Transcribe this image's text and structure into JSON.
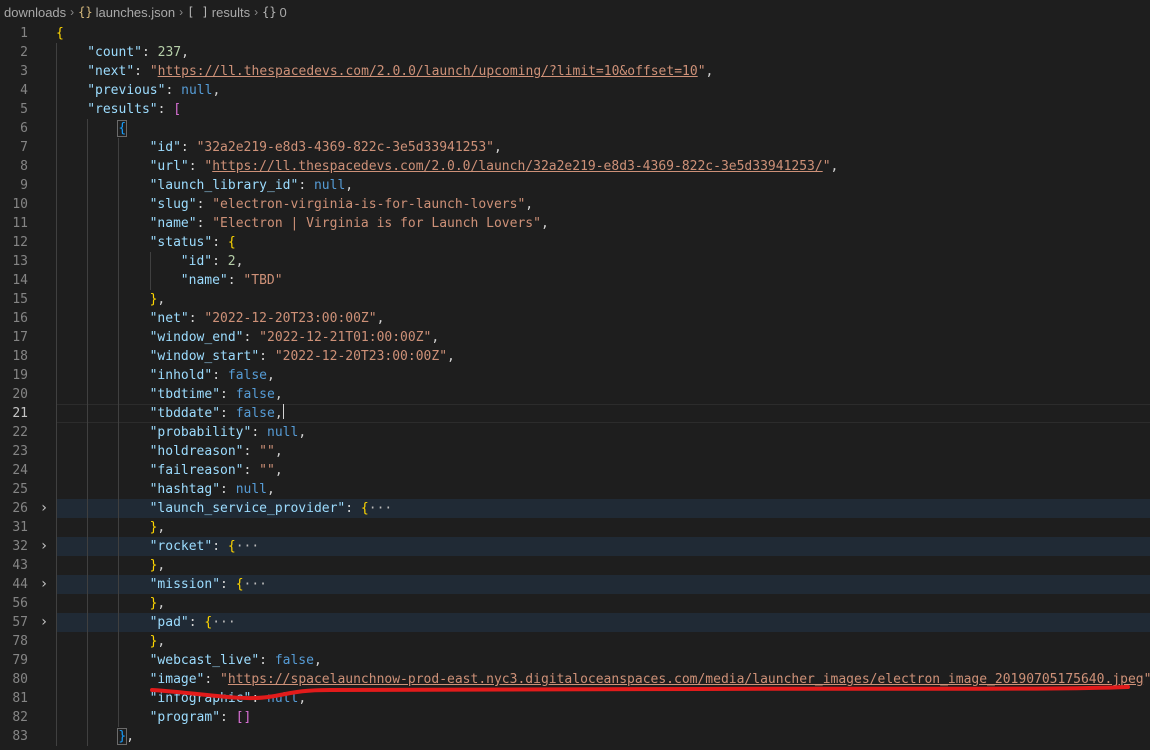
{
  "breadcrumb": {
    "items": [
      {
        "icon": "",
        "label": "downloads"
      },
      {
        "icon": "{}",
        "label": "launches.json"
      },
      {
        "icon": "[ ]",
        "label": "results"
      },
      {
        "icon": "{}",
        "label": "0"
      }
    ]
  },
  "lines": [
    {
      "num": "1",
      "indent": 0,
      "tokens": [
        [
          "{",
          "b1"
        ]
      ]
    },
    {
      "num": "2",
      "indent": 1,
      "tokens": [
        [
          "\"count\"",
          "k"
        ],
        [
          ": ",
          "p"
        ],
        [
          "237",
          "n"
        ],
        [
          ",",
          "p"
        ]
      ]
    },
    {
      "num": "3",
      "indent": 1,
      "tokens": [
        [
          "\"next\"",
          "k"
        ],
        [
          ": ",
          "p"
        ],
        [
          "\"",
          "s"
        ],
        [
          "https://ll.thespacedevs.com/2.0.0/launch/upcoming/?limit=10&offset=10",
          "u"
        ],
        [
          "\"",
          "s"
        ],
        [
          ",",
          "p"
        ]
      ]
    },
    {
      "num": "4",
      "indent": 1,
      "tokens": [
        [
          "\"previous\"",
          "k"
        ],
        [
          ": ",
          "p"
        ],
        [
          "null",
          "kw"
        ],
        [
          ",",
          "p"
        ]
      ]
    },
    {
      "num": "5",
      "indent": 1,
      "tokens": [
        [
          "\"results\"",
          "k"
        ],
        [
          ": ",
          "p"
        ],
        [
          "[",
          "b2"
        ]
      ]
    },
    {
      "num": "6",
      "indent": 2,
      "tokens": [
        [
          "{",
          "b3 box"
        ]
      ]
    },
    {
      "num": "7",
      "indent": 3,
      "tokens": [
        [
          "\"id\"",
          "k"
        ],
        [
          ": ",
          "p"
        ],
        [
          "\"32a2e219-e8d3-4369-822c-3e5d33941253\"",
          "s"
        ],
        [
          ",",
          "p"
        ]
      ]
    },
    {
      "num": "8",
      "indent": 3,
      "tokens": [
        [
          "\"url\"",
          "k"
        ],
        [
          ": ",
          "p"
        ],
        [
          "\"",
          "s"
        ],
        [
          "https://ll.thespacedevs.com/2.0.0/launch/32a2e219-e8d3-4369-822c-3e5d33941253/",
          "u"
        ],
        [
          "\"",
          "s"
        ],
        [
          ",",
          "p"
        ]
      ]
    },
    {
      "num": "9",
      "indent": 3,
      "tokens": [
        [
          "\"launch_library_id\"",
          "k"
        ],
        [
          ": ",
          "p"
        ],
        [
          "null",
          "kw"
        ],
        [
          ",",
          "p"
        ]
      ]
    },
    {
      "num": "10",
      "indent": 3,
      "tokens": [
        [
          "\"slug\"",
          "k"
        ],
        [
          ": ",
          "p"
        ],
        [
          "\"electron-virginia-is-for-launch-lovers\"",
          "s"
        ],
        [
          ",",
          "p"
        ]
      ]
    },
    {
      "num": "11",
      "indent": 3,
      "tokens": [
        [
          "\"name\"",
          "k"
        ],
        [
          ": ",
          "p"
        ],
        [
          "\"Electron | Virginia is for Launch Lovers\"",
          "s"
        ],
        [
          ",",
          "p"
        ]
      ]
    },
    {
      "num": "12",
      "indent": 3,
      "tokens": [
        [
          "\"status\"",
          "k"
        ],
        [
          ": ",
          "p"
        ],
        [
          "{",
          "b1"
        ]
      ]
    },
    {
      "num": "13",
      "indent": 4,
      "tokens": [
        [
          "\"id\"",
          "k"
        ],
        [
          ": ",
          "p"
        ],
        [
          "2",
          "n"
        ],
        [
          ",",
          "p"
        ]
      ]
    },
    {
      "num": "14",
      "indent": 4,
      "tokens": [
        [
          "\"name\"",
          "k"
        ],
        [
          ": ",
          "p"
        ],
        [
          "\"TBD\"",
          "s"
        ]
      ]
    },
    {
      "num": "15",
      "indent": 3,
      "tokens": [
        [
          "}",
          "b1"
        ],
        [
          ",",
          "p"
        ]
      ]
    },
    {
      "num": "16",
      "indent": 3,
      "tokens": [
        [
          "\"net\"",
          "k"
        ],
        [
          ": ",
          "p"
        ],
        [
          "\"2022-12-20T23:00:00Z\"",
          "s"
        ],
        [
          ",",
          "p"
        ]
      ]
    },
    {
      "num": "17",
      "indent": 3,
      "tokens": [
        [
          "\"window_end\"",
          "k"
        ],
        [
          ": ",
          "p"
        ],
        [
          "\"2022-12-21T01:00:00Z\"",
          "s"
        ],
        [
          ",",
          "p"
        ]
      ]
    },
    {
      "num": "18",
      "indent": 3,
      "tokens": [
        [
          "\"window_start\"",
          "k"
        ],
        [
          ": ",
          "p"
        ],
        [
          "\"2022-12-20T23:00:00Z\"",
          "s"
        ],
        [
          ",",
          "p"
        ]
      ]
    },
    {
      "num": "19",
      "indent": 3,
      "tokens": [
        [
          "\"inhold\"",
          "k"
        ],
        [
          ": ",
          "p"
        ],
        [
          "false",
          "kw"
        ],
        [
          ",",
          "p"
        ]
      ]
    },
    {
      "num": "20",
      "indent": 3,
      "tokens": [
        [
          "\"tbdtime\"",
          "k"
        ],
        [
          ": ",
          "p"
        ],
        [
          "false",
          "kw"
        ],
        [
          ",",
          "p"
        ]
      ]
    },
    {
      "num": "21",
      "indent": 3,
      "current": true,
      "tokens": [
        [
          "\"tbddate\"",
          "k"
        ],
        [
          ": ",
          "p"
        ],
        [
          "false",
          "kw"
        ],
        [
          ",",
          "p"
        ]
      ]
    },
    {
      "num": "22",
      "indent": 3,
      "tokens": [
        [
          "\"probability\"",
          "k"
        ],
        [
          ": ",
          "p"
        ],
        [
          "null",
          "kw"
        ],
        [
          ",",
          "p"
        ]
      ]
    },
    {
      "num": "23",
      "indent": 3,
      "tokens": [
        [
          "\"holdreason\"",
          "k"
        ],
        [
          ": ",
          "p"
        ],
        [
          "\"\"",
          "s"
        ],
        [
          ",",
          "p"
        ]
      ]
    },
    {
      "num": "24",
      "indent": 3,
      "tokens": [
        [
          "\"failreason\"",
          "k"
        ],
        [
          ": ",
          "p"
        ],
        [
          "\"\"",
          "s"
        ],
        [
          ",",
          "p"
        ]
      ]
    },
    {
      "num": "25",
      "indent": 3,
      "tokens": [
        [
          "\"hashtag\"",
          "k"
        ],
        [
          ": ",
          "p"
        ],
        [
          "null",
          "kw"
        ],
        [
          ",",
          "p"
        ]
      ]
    },
    {
      "num": "26",
      "indent": 3,
      "folded": true,
      "tokens": [
        [
          "\"launch_service_provider\"",
          "k"
        ],
        [
          ": ",
          "p"
        ],
        [
          "{",
          "b1"
        ],
        [
          "···",
          "ell"
        ]
      ]
    },
    {
      "num": "31",
      "indent": 3,
      "tokens": [
        [
          "}",
          "b1"
        ],
        [
          ",",
          "p"
        ]
      ]
    },
    {
      "num": "32",
      "indent": 3,
      "folded": true,
      "tokens": [
        [
          "\"rocket\"",
          "k"
        ],
        [
          ": ",
          "p"
        ],
        [
          "{",
          "b1"
        ],
        [
          "···",
          "ell"
        ]
      ]
    },
    {
      "num": "43",
      "indent": 3,
      "tokens": [
        [
          "}",
          "b1"
        ],
        [
          ",",
          "p"
        ]
      ]
    },
    {
      "num": "44",
      "indent": 3,
      "folded": true,
      "tokens": [
        [
          "\"mission\"",
          "k"
        ],
        [
          ": ",
          "p"
        ],
        [
          "{",
          "b1"
        ],
        [
          "···",
          "ell"
        ]
      ]
    },
    {
      "num": "56",
      "indent": 3,
      "tokens": [
        [
          "}",
          "b1"
        ],
        [
          ",",
          "p"
        ]
      ]
    },
    {
      "num": "57",
      "indent": 3,
      "folded": true,
      "tokens": [
        [
          "\"pad\"",
          "k"
        ],
        [
          ": ",
          "p"
        ],
        [
          "{",
          "b1"
        ],
        [
          "···",
          "ell"
        ]
      ]
    },
    {
      "num": "78",
      "indent": 3,
      "tokens": [
        [
          "}",
          "b1"
        ],
        [
          ",",
          "p"
        ]
      ]
    },
    {
      "num": "79",
      "indent": 3,
      "tokens": [
        [
          "\"webcast_live\"",
          "k"
        ],
        [
          ": ",
          "p"
        ],
        [
          "false",
          "kw"
        ],
        [
          ",",
          "p"
        ]
      ]
    },
    {
      "num": "80",
      "indent": 3,
      "tokens": [
        [
          "\"image\"",
          "k"
        ],
        [
          ": ",
          "p"
        ],
        [
          "\"",
          "s"
        ],
        [
          "https://spacelaunchnow-prod-east.nyc3.digitaloceanspaces.com/media/launcher_images/electron_image_20190705175640.jpeg",
          "u"
        ],
        [
          "\"",
          "s"
        ],
        [
          ",",
          "p"
        ]
      ]
    },
    {
      "num": "81",
      "indent": 3,
      "tokens": [
        [
          "\"infographic\"",
          "k"
        ],
        [
          ": ",
          "p"
        ],
        [
          "null",
          "kw"
        ],
        [
          ",",
          "p"
        ]
      ]
    },
    {
      "num": "82",
      "indent": 3,
      "tokens": [
        [
          "\"program\"",
          "k"
        ],
        [
          ": ",
          "p"
        ],
        [
          "[]",
          "b2"
        ]
      ]
    },
    {
      "num": "83",
      "indent": 2,
      "tokens": [
        [
          "}",
          "b3 box"
        ],
        [
          ",",
          "p"
        ]
      ]
    }
  ],
  "colors": {
    "background": "#1e1e1e",
    "key": "#9cdcfe",
    "string": "#ce9178",
    "number": "#b5cea8",
    "keyword": "#569cd6",
    "annotation": "#e21b1b"
  },
  "icons": {
    "fold": "chevron-right-icon",
    "object": "braces-icon",
    "array": "brackets-icon"
  }
}
